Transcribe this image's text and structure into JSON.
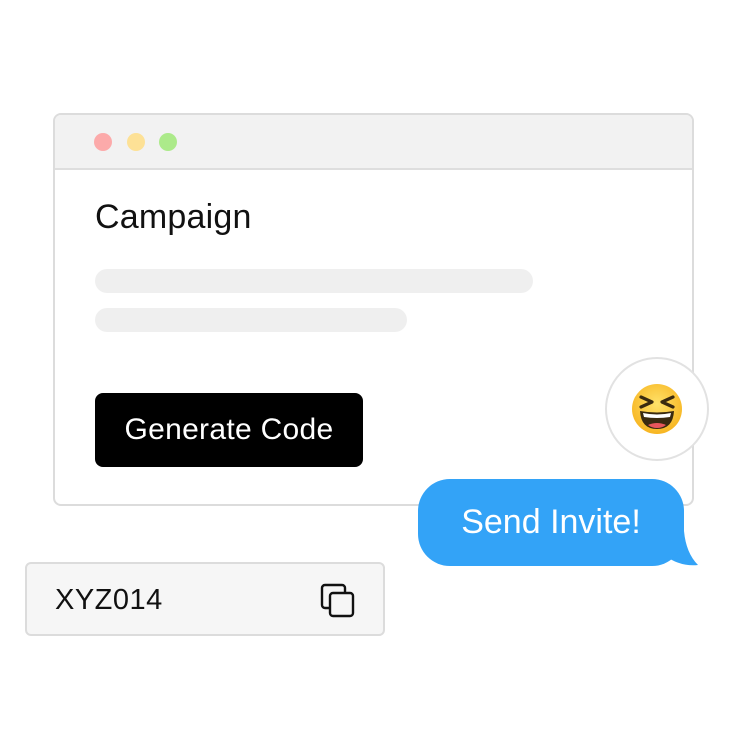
{
  "window": {
    "title": "Campaign",
    "traffic_lights": [
      "#fcaaaa",
      "#fde196",
      "#acea8a"
    ],
    "generate_button_label": "Generate Code"
  },
  "reaction": {
    "icon": "grinning-squinting-face-icon"
  },
  "message": {
    "text": "Send Invite!",
    "color": "#33a3f7"
  },
  "code": {
    "value": "XYZ014",
    "copy_icon": "copy-icon"
  }
}
